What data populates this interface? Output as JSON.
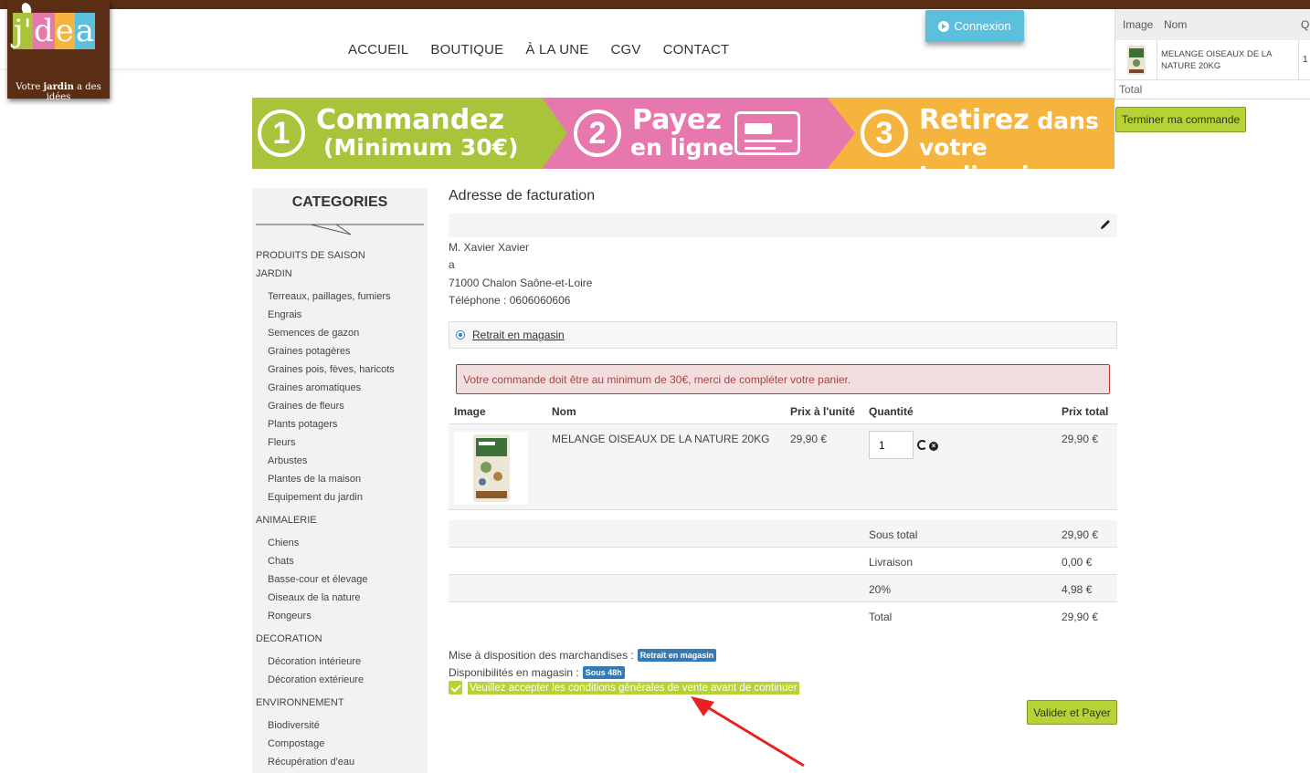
{
  "brand": {
    "logo_letters": [
      "j'",
      "d",
      "e",
      "a"
    ],
    "logo_colors": [
      "#a9c43a",
      "#e678ad",
      "#f4b43e",
      "#5bc0de"
    ],
    "tagline_pre": "Votre ",
    "tagline_bold": "jardin",
    "tagline_post": " a des idées"
  },
  "nav": {
    "items": [
      "ACCUEIL",
      "BOUTIQUE",
      "À LA UNE",
      "CGV",
      "CONTACT"
    ]
  },
  "header": {
    "login_label": "Connexion"
  },
  "mini_cart": {
    "col_image": "Image",
    "col_name": "Nom",
    "col_qty": "Q",
    "item_name": "MELANGE OISEAUX DE LA NATURE 20KG",
    "item_qty": "1",
    "total_label": "Total",
    "checkout_label": "Terminer ma commande"
  },
  "banner": {
    "step1_num": "1",
    "step1_line1": "Commandez",
    "step1_line2": "(Minimum 30€)",
    "step2_num": "2",
    "step2_line1": "Payez",
    "step2_line2": "en ligne",
    "step3_num": "3",
    "step3_line1a": "Retirez",
    "step3_line1b": " dans",
    "step3_line2": "votre Jardinerie"
  },
  "sidebar": {
    "title": "CATEGORIES",
    "items": [
      {
        "label": "PRODUITS DE SAISON",
        "level": "top"
      },
      {
        "label": "JARDIN",
        "level": "top"
      },
      {
        "label": "Terreaux, paillages, fumiers",
        "level": "sub"
      },
      {
        "label": "Engrais",
        "level": "sub"
      },
      {
        "label": "Semences de gazon",
        "level": "sub"
      },
      {
        "label": "Graines potagères",
        "level": "sub"
      },
      {
        "label": "Graines pois, fèves, haricots",
        "level": "sub"
      },
      {
        "label": "Graines aromatiques",
        "level": "sub"
      },
      {
        "label": "Graines de fleurs",
        "level": "sub"
      },
      {
        "label": "Plants potagers",
        "level": "sub"
      },
      {
        "label": "Fleurs",
        "level": "sub"
      },
      {
        "label": "Arbustes",
        "level": "sub"
      },
      {
        "label": "Plantes de la maison",
        "level": "sub"
      },
      {
        "label": "Equipement du jardin",
        "level": "sub"
      },
      {
        "label": "ANIMALERIE",
        "level": "top"
      },
      {
        "label": "Chiens",
        "level": "sub"
      },
      {
        "label": "Chats",
        "level": "sub"
      },
      {
        "label": "Basse-cour et élevage",
        "level": "sub"
      },
      {
        "label": "Oiseaux de la nature",
        "level": "sub"
      },
      {
        "label": "Rongeurs",
        "level": "sub"
      },
      {
        "label": "DECORATION",
        "level": "top"
      },
      {
        "label": "Décoration intérieure",
        "level": "sub"
      },
      {
        "label": "Décoration extérieure",
        "level": "sub"
      },
      {
        "label": "ENVIRONNEMENT",
        "level": "top"
      },
      {
        "label": "Biodiversité",
        "level": "sub"
      },
      {
        "label": "Compostage",
        "level": "sub"
      },
      {
        "label": "Récupération d'eau",
        "level": "sub"
      }
    ]
  },
  "billing": {
    "title": "Adresse de facturation",
    "lines": [
      "M. Xavier Xavier",
      "a",
      "71000 Chalon Saône-et-Loire",
      "Téléphone : 0606060606"
    ]
  },
  "delivery": {
    "option_label": "Retrait en magasin"
  },
  "alert": {
    "message": "Votre commande doit être au minimum de 30€, merci de compléter votre panier."
  },
  "cart": {
    "headers": {
      "image": "Image",
      "name": "Nom",
      "unit_price": "Prix à l'unité",
      "quantity": "Quantité",
      "total": "Prix total"
    },
    "item": {
      "name": "MELANGE OISEAUX DE LA NATURE 20KG",
      "unit_price": "29,90 €",
      "quantity": "1",
      "total": "29,90 €"
    },
    "totals": [
      {
        "label": "Sous total",
        "value": "29,90 €"
      },
      {
        "label": "Livraison",
        "value": "0,00 €"
      },
      {
        "label": "20%",
        "value": "4,98 €"
      },
      {
        "label": "Total",
        "value": "29,90 €"
      }
    ]
  },
  "availability": {
    "mise_label": "Mise à disposition des marchandises :",
    "mise_badge": "Retrait en magasin",
    "dispo_label": "Disponibilités en magasin :",
    "dispo_badge": "Sous 48h"
  },
  "cgv": {
    "label": "Veuillez accepter les conditions générales de vente avant de continuer",
    "checked": true
  },
  "actions": {
    "validate_label": "Valider et Payer"
  },
  "colors": {
    "accent_green": "#b5d334",
    "brand_brown": "#5a2e14",
    "login_blue": "#5bc0de",
    "annotation_red": "#e8231f"
  }
}
